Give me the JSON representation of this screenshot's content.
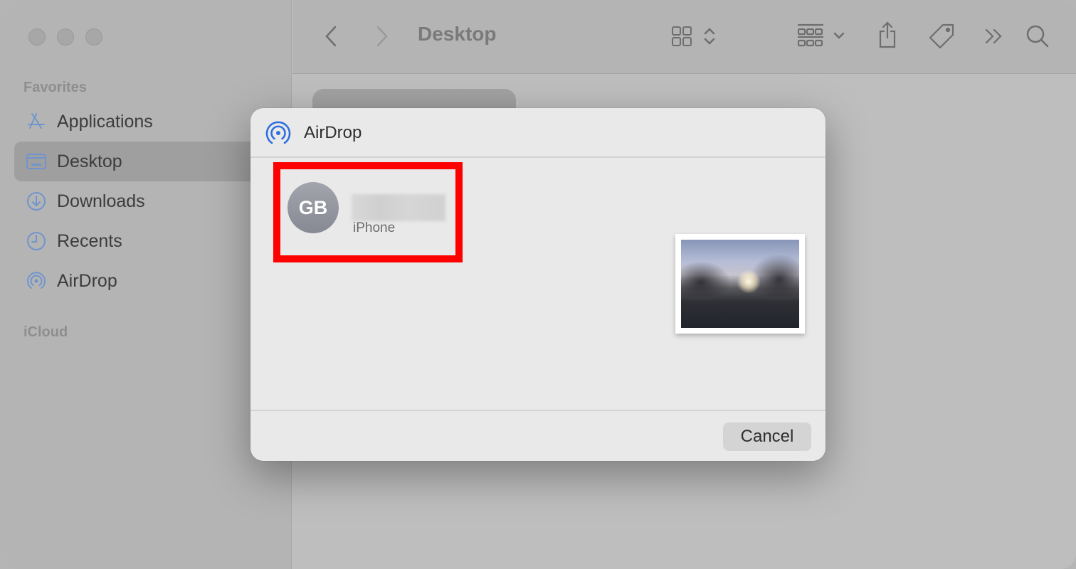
{
  "window": {
    "traffic_lights": [
      "close",
      "minimize",
      "zoom"
    ]
  },
  "toolbar": {
    "title": "Desktop",
    "icons": [
      "back-icon",
      "forward-icon",
      "icon-view-icon",
      "view-options-chevron-icon",
      "group-icon",
      "group-chevron-icon",
      "share-icon",
      "tag-icon",
      "more-icon",
      "search-icon"
    ]
  },
  "sidebar": {
    "sections": [
      {
        "title": "Favorites",
        "items": [
          {
            "label": "Applications",
            "icon": "applications-icon",
            "selected": false
          },
          {
            "label": "Desktop",
            "icon": "desktop-icon",
            "selected": true
          },
          {
            "label": "Downloads",
            "icon": "downloads-icon",
            "selected": false
          },
          {
            "label": "Recents",
            "icon": "recents-icon",
            "selected": false
          },
          {
            "label": "AirDrop",
            "icon": "airdrop-icon",
            "selected": false
          }
        ]
      },
      {
        "title": "iCloud",
        "items": []
      }
    ]
  },
  "dialog": {
    "title": "AirDrop",
    "icon": "airdrop-icon",
    "device": {
      "initials": "GB",
      "name": "",
      "type": "iPhone",
      "highlighted": true
    },
    "cancel_label": "Cancel"
  },
  "colors": {
    "accent_blue": "#2f6fde",
    "sidebar_icon_blue": "#6f95cc",
    "highlight_red": "#ff0000"
  }
}
